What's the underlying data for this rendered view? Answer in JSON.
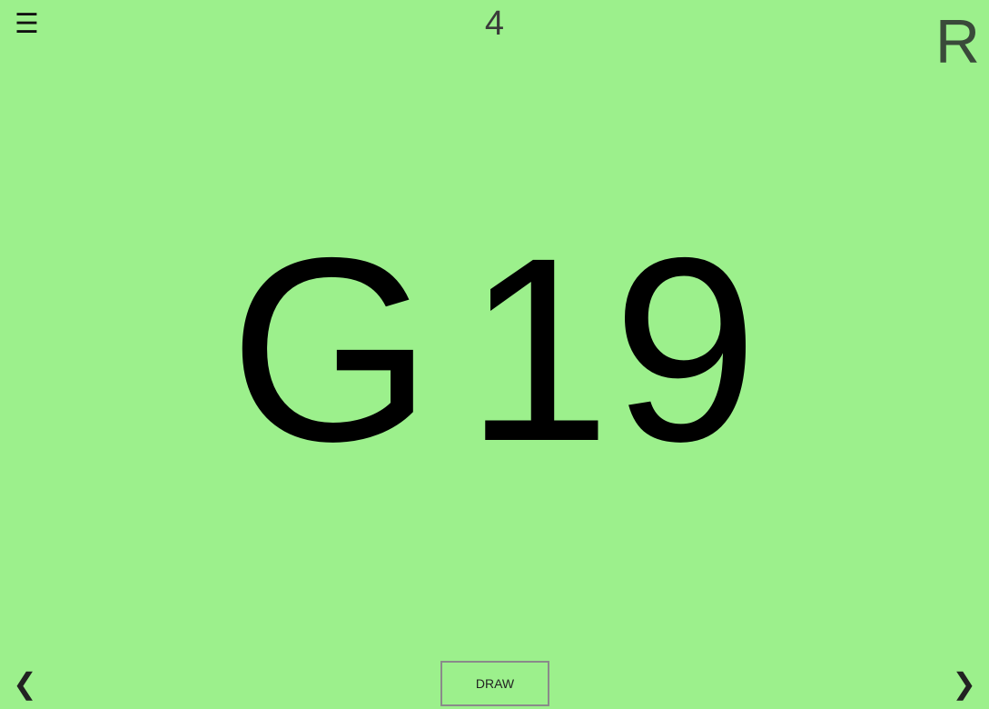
{
  "header": {
    "menu_icon": "☰",
    "draw_count": "4",
    "reset_label": "R"
  },
  "call": {
    "letter": "G",
    "number": "19"
  },
  "footer": {
    "prev_icon": "❮",
    "next_icon": "❯",
    "draw_label": "DRAW"
  },
  "colors": {
    "background": "#9cf08c"
  }
}
